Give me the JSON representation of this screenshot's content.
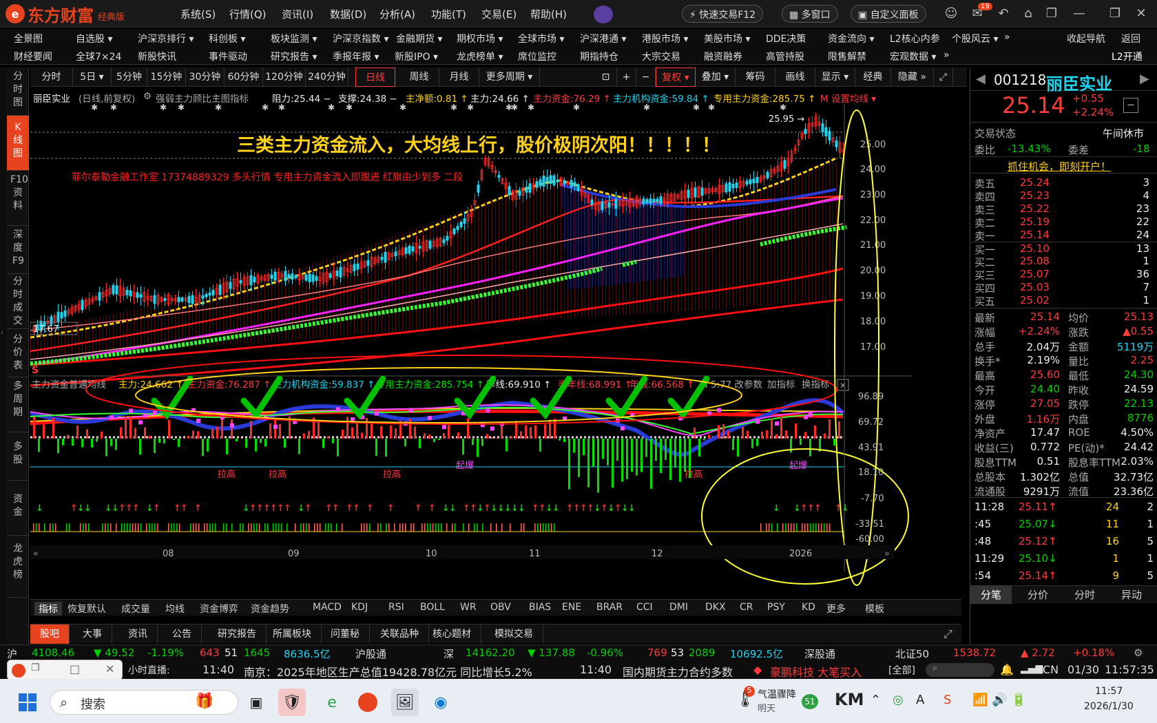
{
  "app": {
    "brand": "东方财富",
    "edition": "经典版",
    "brand_color": "#e8431f"
  },
  "title_menu": [
    "系统(S)",
    "行情(Q)",
    "资讯(I)",
    "数据(D)",
    "分析(A)",
    "功能(T)",
    "交易(E)",
    "帮助(H)"
  ],
  "title_buttons": {
    "quick_trade": "快速交易F12",
    "multi_window": "多窗口",
    "custom_panel": "自定义面板",
    "mail_badge": "19"
  },
  "nav1": [
    "全景图",
    "自选股 ▾",
    "沪深京排行 ▾",
    "科创板 ▾",
    "板块监测 ▾",
    "沪深京指数 ▾",
    "金融期货 ▾",
    "期权市场 ▾",
    "全球市场 ▾",
    "沪深港通 ▾",
    "港股市场 ▾",
    "美股市场 ▾",
    "DDE决策",
    "资金流向 ▾",
    "L2核心内参",
    "个股风云 ▾",
    "»",
    "收起导航",
    "返回"
  ],
  "nav2": [
    "财经要闻",
    "全球7×24",
    "新股快讯",
    "事件驱动",
    "研究报告 ▾",
    "季报年报 ▾",
    "新股IPO ▾",
    "龙虎榜单 ▾",
    "席位监控",
    "期指持仓",
    "大宗交易",
    "融资融券",
    "高管持股",
    "限售解禁",
    "宏观数据 ▾",
    "»",
    "L2开通"
  ],
  "left_tabs": [
    "分时图",
    "K线图",
    "F10资料",
    "深度F9",
    "分时成交",
    "分价表",
    "多周期",
    "多股",
    "资金",
    "龙虎榜"
  ],
  "period_tabs": [
    "分时",
    "5日 ▾",
    "5分钟",
    "15分钟",
    "30分钟",
    "60分钟",
    "120分钟",
    "240分钟",
    "日线",
    "周线",
    "月线",
    "更多周期 ▾"
  ],
  "tool_tabs": [
    "复权 ▾",
    "叠加 ▾",
    "筹码",
    "画线",
    "显示 ▾",
    "经典",
    "隐藏 »"
  ],
  "legend": {
    "name": "丽臣实业",
    "mode": "(日线,前复权)",
    "indicator": "强弱主力顾比主图指标",
    "items": [
      {
        "text": "阻力:25.44 −",
        "color": "#eeeeee"
      },
      {
        "text": "支撑:24.38 −",
        "color": "#eeeeee"
      },
      {
        "text": "主净额:0.81 ↑",
        "color": "#ffd21a"
      },
      {
        "text": "主力:24.66 ↑",
        "color": "#eeeeee"
      },
      {
        "text": "主力资金:76.29 ↑",
        "color": "#ff3b3b"
      },
      {
        "text": "主力机构资金:59.84 ↑",
        "color": "#22d3ee"
      },
      {
        "text": "专用主力资金:285.75 ↑",
        "color": "#ffd21a"
      },
      {
        "text": "M 设置均线 ▾",
        "color": "#ff3b3b"
      }
    ]
  },
  "headline": "三类主力资金流入，大均线上行，股价极阴次阳！！！！！",
  "subline": "菲尔泰勒金融工作室 17374889329 多头行情 专用主力资金流入即跟进 红旗由少到多 二段",
  "price_axis": [
    "25.00",
    "24.00",
    "23.00",
    "22.00",
    "21.00",
    "20.00",
    "19.00",
    "18.00",
    "17.00"
  ],
  "high_mark": "25.95 →",
  "low_mark": "17.67",
  "sub_legend": {
    "name": "主力资金普通均线",
    "items": [
      {
        "text": "主力:24.662 ↑",
        "color": "#ffd21a"
      },
      {
        "text": "主力资金:76.287 ↑",
        "color": "#ff3b3b"
      },
      {
        "text": "主力机构资金:59.837 ↑",
        "color": "#22d3ee"
      },
      {
        "text": "专用主力资金:285.754 ↑",
        "color": "#00e000"
      },
      {
        "text": "季线:69.910 ↑",
        "color": "#eeeeee"
      },
      {
        "text": "半年线:68.991 ↑",
        "color": "#ff3b3b"
      },
      {
        "text": "年线:66.568 ↑",
        "color": "#ff3b3b"
      },
      {
        "text": "M 5:77 改参数",
        "color": "#aaaaaa"
      },
      {
        "text": "加指标",
        "color": "#aaaaaa"
      },
      {
        "text": "换指标",
        "color": "#aaaaaa"
      }
    ]
  },
  "sub_axis": [
    "96.89",
    "69.72",
    "43.91",
    "18.10",
    "-7.70",
    "-33.51",
    "-60.00"
  ],
  "sub_labels": [
    "拉高",
    "拉高",
    "拉高",
    "起爆",
    "拉高",
    "起爆"
  ],
  "x_axis": [
    "08",
    "09",
    "10",
    "11",
    "12",
    "2026"
  ],
  "indicator_tabs": [
    "指标",
    "恢复默认",
    "成交量",
    "均线",
    "资金博弈",
    "资金趋势",
    "MACD",
    "KDJ",
    "RSI",
    "BOLL",
    "WR",
    "OBV",
    "BIAS",
    "ENE",
    "BRAR",
    "CCI",
    "DMI",
    "DKX",
    "CR",
    "PSY",
    "KD",
    "更多",
    "模板"
  ],
  "bottom_tabs": [
    "股吧",
    "大事",
    "资讯",
    "公告",
    "研究报告",
    "所属板块",
    "问董秘",
    "关联品种",
    "核心题材",
    "模拟交易"
  ],
  "quote": {
    "code": "001218",
    "name": "丽臣实业",
    "price": "25.14",
    "change": "+0.55",
    "pct": "+2.24%",
    "trade_status_label": "交易状态",
    "trade_status": "午间休市",
    "weibi_label": "委比",
    "weibi": "-13.43%",
    "weicha_label": "委差",
    "weicha": "-18",
    "promo": "抓住机会，即刻开户！",
    "asks": [
      [
        "卖五",
        "25.24",
        "3"
      ],
      [
        "卖四",
        "25.23",
        "4"
      ],
      [
        "卖三",
        "25.22",
        "23"
      ],
      [
        "卖二",
        "25.19",
        "22"
      ],
      [
        "卖一",
        "25.14",
        "24"
      ]
    ],
    "bids": [
      [
        "买一",
        "25.10",
        "13"
      ],
      [
        "买二",
        "25.08",
        "1"
      ],
      [
        "买三",
        "25.07",
        "36"
      ],
      [
        "买四",
        "25.03",
        "7"
      ],
      [
        "买五",
        "25.02",
        "1"
      ]
    ],
    "stats": [
      [
        "最新",
        "25.14",
        "red",
        "均价",
        "25.13",
        "red"
      ],
      [
        "涨幅",
        "+2.24%",
        "red",
        "涨跌",
        "▲0.55",
        "red"
      ],
      [
        "总手",
        "2.04万",
        "wht",
        "金额",
        "5119万",
        "cyan"
      ],
      [
        "换手*",
        "2.19%",
        "wht",
        "量比",
        "2.25",
        "red"
      ],
      [
        "最高",
        "25.60",
        "red",
        "最低",
        "24.30",
        "grn"
      ],
      [
        "今开",
        "24.40",
        "grn",
        "昨收",
        "24.59",
        "wht"
      ],
      [
        "涨停",
        "27.05",
        "red",
        "跌停",
        "22.13",
        "grn"
      ],
      [
        "外盘",
        "1.16万",
        "red",
        "内盘",
        "8776",
        "grn"
      ],
      [
        "净资产",
        "17.47",
        "wht",
        "ROE",
        "4.50%",
        "wht"
      ],
      [
        "收益(三)",
        "0.772",
        "wht",
        "PE(动)*",
        "24.42",
        "wht"
      ],
      [
        "股息TTM",
        "0.51",
        "wht",
        "股息率TTM",
        "2.03%",
        "wht"
      ],
      [
        "总股本",
        "1.302亿",
        "wht",
        "总值",
        "32.73亿",
        "wht"
      ],
      [
        "流通股",
        "9291万",
        "wht",
        "流值",
        "23.36亿",
        "wht"
      ]
    ],
    "ticks": [
      [
        "11:28",
        "25.11↑",
        "red",
        "24",
        "2"
      ],
      [
        ":45",
        "25.07↓",
        "grn",
        "11",
        "1"
      ],
      [
        ":48",
        "25.12↑",
        "red",
        "16",
        "5"
      ],
      [
        "11:29",
        "25.10↓",
        "grn",
        "1",
        "1"
      ],
      [
        ":54",
        "25.14↑",
        "red",
        "9",
        "5"
      ]
    ],
    "right_tabs": [
      "分笔",
      "分价",
      "分时",
      "异动"
    ]
  },
  "statusbar": {
    "sh_label": "沪",
    "sh_index": "4108.46",
    "sh_chg": "▼ 49.52",
    "sh_pct": "-1.19%",
    "sh_up": "643",
    "sh_flat": "51",
    "sh_down": "1645",
    "sh_amt": "8636.5亿",
    "hgt": "沪股通",
    "sz_label": "深",
    "sz_index": "14162.20",
    "sz_chg": "▼ 137.88",
    "sz_pct": "-0.96%",
    "sz_up": "769",
    "sz_flat": "53",
    "sz_down": "2089",
    "sz_amt": "10692.5亿",
    "sgt": "深股通",
    "bz_label": "北证50",
    "bz_index": "1538.72",
    "bz_chg": "▲ 2.72",
    "bz_pct": "+0.18%"
  },
  "ticker": {
    "live": "小时直播:",
    "t1": "11:40",
    "news1": "南京：2025年地区生产总值19428.78亿元 同比增长5.2%",
    "t2": "11:40",
    "news2": "国内期货主力合约多数",
    "alert": "豪鹏科技 大笔买入",
    "all": "[全部]",
    "region": "CN",
    "date": "01/30",
    "time": "11:57:35"
  },
  "taskbar": {
    "search": "搜索",
    "weather": "气温骤降",
    "weather_sub": "明天",
    "temp_badge": "51",
    "clock": "11:57",
    "date": "2026/1/30",
    "notif": "5"
  }
}
